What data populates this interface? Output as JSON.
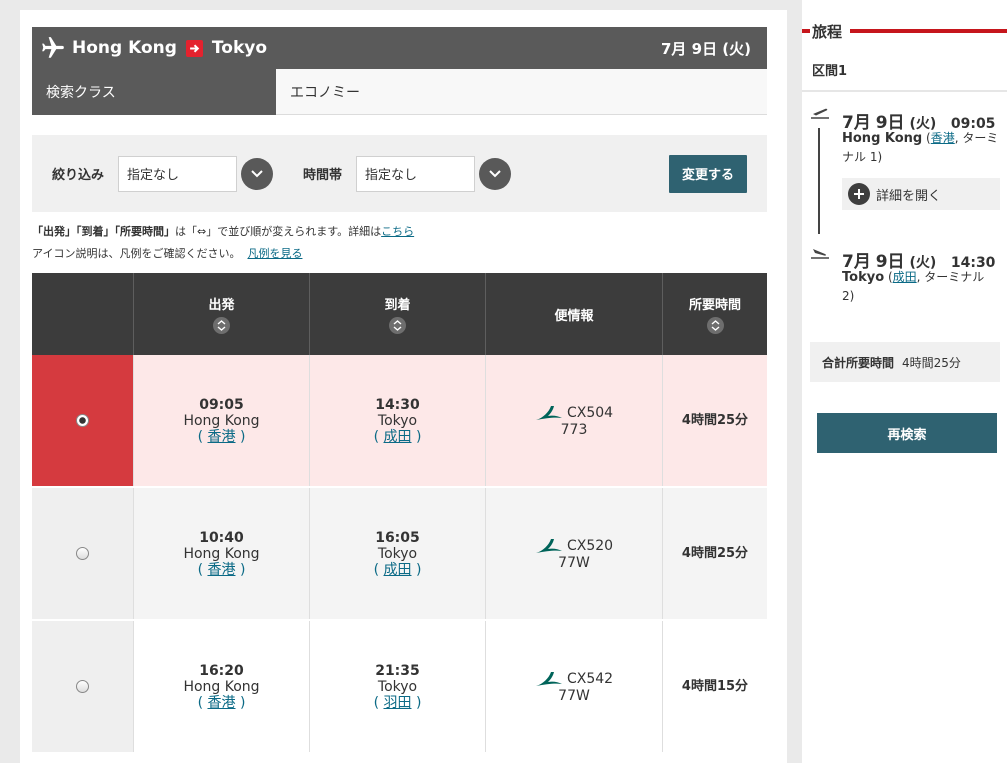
{
  "route": {
    "origin": "Hong Kong",
    "destination": "Tokyo",
    "date": "7月 9日 (火)"
  },
  "search_class": {
    "label": "検索クラス",
    "value": "エコノミー"
  },
  "filters": {
    "narrow_label": "絞り込み",
    "narrow_value": "指定なし",
    "time_label": "時間帯",
    "time_value": "指定なし",
    "change_button": "変更する"
  },
  "notes": {
    "line1_strong": "「出発」「到着」「所要時間」",
    "line1_rest": "は「⇔」で並び順が変えられます。詳細は",
    "line1_link": "こちら",
    "line2_text": "アイコン説明は、凡例をご確認ください。",
    "line2_link": "凡例を見る"
  },
  "table": {
    "headers": {
      "departure": "出発",
      "arrival": "到着",
      "flight_info": "便情報",
      "duration": "所要時間"
    },
    "rows": [
      {
        "selected": true,
        "dep_time": "09:05",
        "dep_city": "Hong Kong",
        "dep_airport": "香港",
        "arr_time": "14:30",
        "arr_city": "Tokyo",
        "arr_airport": "成田",
        "flight_no": "CX504",
        "aircraft": "773",
        "duration": "4時間25分"
      },
      {
        "selected": false,
        "dep_time": "10:40",
        "dep_city": "Hong Kong",
        "dep_airport": "香港",
        "arr_time": "16:05",
        "arr_city": "Tokyo",
        "arr_airport": "成田",
        "flight_no": "CX520",
        "aircraft": "77W",
        "duration": "4時間25分"
      },
      {
        "selected": false,
        "dep_time": "16:20",
        "dep_city": "Hong Kong",
        "dep_airport": "香港",
        "arr_time": "21:35",
        "arr_city": "Tokyo",
        "arr_airport": "羽田",
        "flight_no": "CX542",
        "aircraft": "77W",
        "duration": "4時間15分"
      }
    ]
  },
  "sidebar": {
    "title": "旅程",
    "segment": "区間1",
    "departure": {
      "month": "7月",
      "day": "9日",
      "weekday": "(火)",
      "time": "09:05",
      "city": "Hong Kong",
      "airport": "香港",
      "terminal": "ターミナル 1"
    },
    "detail_button": "詳細を開く",
    "arrival": {
      "month": "7月",
      "day": "9日",
      "weekday": "(火)",
      "time": "14:30",
      "city": "Tokyo",
      "airport": "成田",
      "terminal": "ターミナル 2"
    },
    "total_label": "合計所要時間",
    "total_value": "4時間25分",
    "research_button": "再検索"
  },
  "colors": {
    "header_bg": "#5a5a5a",
    "accent_red": "#d53a3f",
    "button_teal": "#2f6271",
    "link": "#0b6a86"
  }
}
